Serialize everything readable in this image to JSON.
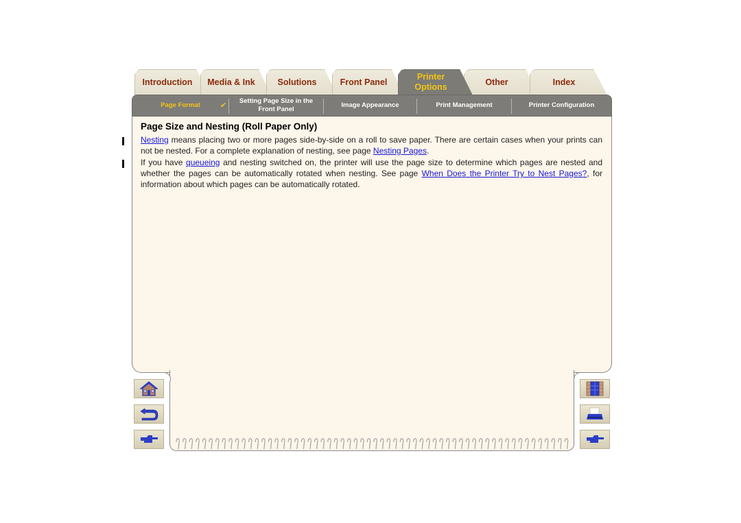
{
  "tabs": [
    {
      "label": "Introduction",
      "active": false
    },
    {
      "label": "Media & Ink",
      "active": false
    },
    {
      "label": "Solutions",
      "active": false
    },
    {
      "label": "Front Panel",
      "active": false
    },
    {
      "label_line1": "Printer",
      "label_line2": "Options",
      "active": true
    },
    {
      "label": "Other",
      "active": false
    },
    {
      "label": "Index",
      "active": false
    }
  ],
  "subnav": [
    {
      "label": "Page Format",
      "current": true,
      "check": "✔"
    },
    {
      "label_line1": "Setting Page Size in the",
      "label_line2": "Front Panel"
    },
    {
      "label": "Image Appearance"
    },
    {
      "label": "Print Management"
    },
    {
      "label": "Printer Configuration"
    }
  ],
  "content": {
    "title": "Page Size and Nesting (Roll Paper Only)",
    "p1": {
      "link1": "Nesting",
      "text1": " means placing two or more pages side-by-side on a roll to save paper. There are certain cases when your prints can not be nested. For a complete explanation of nesting, see page ",
      "link2": "Nesting Pages",
      "text2": "."
    },
    "p2": {
      "text1": "If you have ",
      "link1": "queueing",
      "text2": " and nesting switched on, the printer will use the page size to determine which pages are nested and whether the pages can be automatically rotated when nesting. See page ",
      "link2": "When Does the Printer Try to Nest Pages?",
      "text3": ", for information about which pages can be automatically rotated."
    }
  },
  "nav_left": [
    {
      "icon": "home-icon"
    },
    {
      "icon": "back-icon"
    },
    {
      "icon": "next-page-icon"
    }
  ],
  "nav_right": [
    {
      "icon": "exit-door-icon"
    },
    {
      "icon": "printer-icon"
    },
    {
      "icon": "next-page-icon"
    }
  ],
  "colors": {
    "tab_text": "#8b2a0c",
    "active_text": "#f3c515",
    "bar": "#7d7c78",
    "page_bg": "#fdf6ea",
    "link": "#1717d6"
  }
}
